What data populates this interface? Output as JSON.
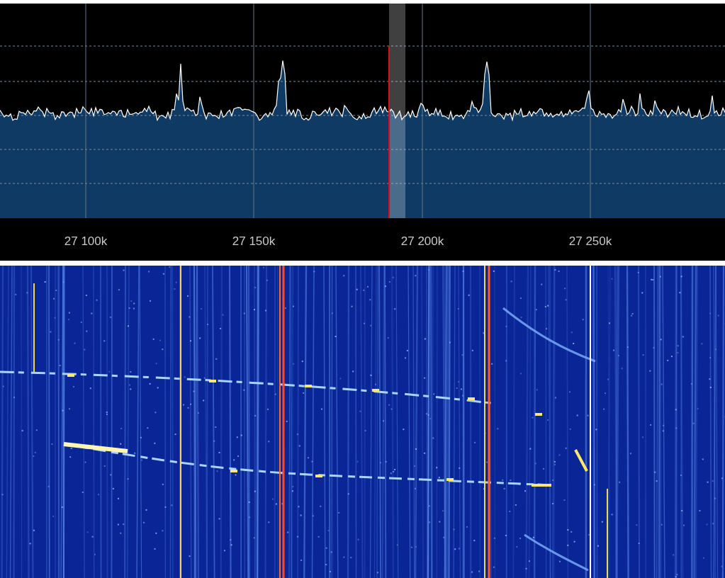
{
  "frequency_axis": {
    "labels": [
      "27 100k",
      "27 150k",
      "27 200k",
      "27 250k"
    ]
  }
}
